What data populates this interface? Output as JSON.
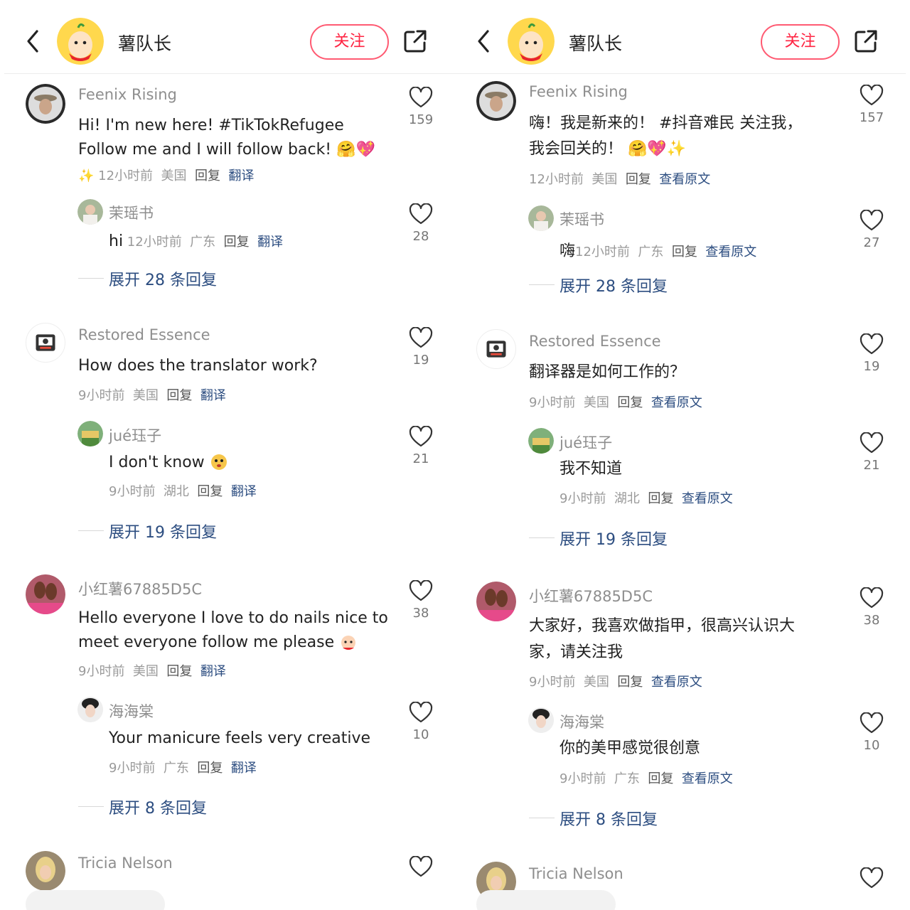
{
  "panels": [
    {
      "header": {
        "title": "薯队长",
        "follow_label": "关注"
      },
      "comments": [
        {
          "username": "Feenix Rising",
          "text_lines": [
            "Hi! I'm new here! #TikTokRefugee",
            "Follow me and I will follow back! 🤗💖"
          ],
          "sparkle": "✨",
          "time": "12小时前",
          "region": "美国",
          "reply": "回复",
          "translate": "翻译",
          "likes": "159",
          "sub": {
            "username": "茉瑶书",
            "text": "hi",
            "time": "12小时前",
            "region": "广东",
            "reply": "回复",
            "translate": "翻译",
            "likes": "28"
          },
          "expand": "展开 28 条回复"
        },
        {
          "username": "Restored Essence",
          "text_lines": [
            "How does the translator work?"
          ],
          "time": "9小时前",
          "region": "美国",
          "reply": "回复",
          "translate": "翻译",
          "likes": "19",
          "sub": {
            "username": "jué珏子",
            "text": "I don't know",
            "time": "9小时前",
            "region": "湖北",
            "reply": "回复",
            "translate": "翻译",
            "likes": "21"
          },
          "expand": "展开 19 条回复"
        },
        {
          "username": "小红薯67885D5C",
          "text_lines": [
            "Hello everyone I love to do nails nice to",
            "meet everyone follow me please"
          ],
          "time": "9小时前",
          "region": "美国",
          "reply": "回复",
          "translate": "翻译",
          "likes": "38",
          "sub": {
            "username": "海海棠",
            "text": "Your manicure feels very creative",
            "time": "9小时前",
            "region": "广东",
            "reply": "回复",
            "translate": "翻译",
            "likes": "10"
          },
          "expand": "展开 8 条回复"
        },
        {
          "username": "Tricia Nelson"
        }
      ]
    },
    {
      "header": {
        "title": "薯队长",
        "follow_label": "关注"
      },
      "comments": [
        {
          "username": "Feenix Rising",
          "text_lines": [
            "嗨！我是新来的！ #抖音难民 关注我，",
            "我会回关的！ 🤗💖✨"
          ],
          "time": "12小时前",
          "region": "美国",
          "reply": "回复",
          "translate": "查看原文",
          "likes": "157",
          "sub": {
            "username": "茉瑶书",
            "text": "嗨",
            "time": "12小时前",
            "region": "广东",
            "reply": "回复",
            "translate": "查看原文",
            "likes": "27"
          },
          "expand": "展开 28 条回复"
        },
        {
          "username": "Restored Essence",
          "text_lines": [
            "翻译器是如何工作的？"
          ],
          "time": "9小时前",
          "region": "美国",
          "reply": "回复",
          "translate": "查看原文",
          "likes": "19",
          "sub": {
            "username": "jué珏子",
            "text": "我不知道",
            "time": "9小时前",
            "region": "湖北",
            "reply": "回复",
            "translate": "查看原文",
            "likes": "21"
          },
          "expand": "展开 19 条回复"
        },
        {
          "username": "小红薯67885D5C",
          "text_lines": [
            "大家好，我喜欢做指甲，很高兴认识大",
            "家，请关注我"
          ],
          "time": "9小时前",
          "region": "美国",
          "reply": "回复",
          "translate": "查看原文",
          "likes": "38",
          "sub": {
            "username": "海海棠",
            "text": "你的美甲感觉很创意",
            "time": "9小时前",
            "region": "广东",
            "reply": "回复",
            "translate": "查看原文",
            "likes": "10"
          },
          "expand": "展开 8 条回复"
        },
        {
          "username": "Tricia Nelson"
        }
      ]
    }
  ],
  "icons": {
    "back": "chevron-left-icon",
    "share": "share-external-icon",
    "like": "heart-outline-icon"
  },
  "colors": {
    "follow": "#ff2442",
    "link": "#2c4d80",
    "muted": "#9a9a9a"
  }
}
